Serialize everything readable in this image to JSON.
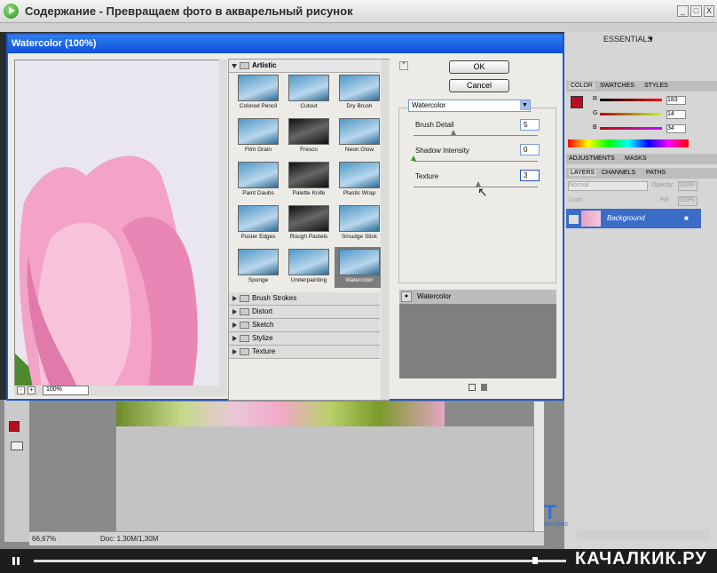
{
  "player": {
    "title": "Содержание - Превращаем фото в акварельный рисунок",
    "watermark": "КАЧАЛКИК.РУ",
    "min": "_",
    "max": "□",
    "close": "X"
  },
  "ps": {
    "essentials": "ESSENTIALS",
    "zoom": "66,67%",
    "doc": "Doc: 1,30M/1,30M"
  },
  "dialog": {
    "title": "Watercolor (100%)",
    "preview_zoom": "100%",
    "ok": "OK",
    "cancel": "Cancel",
    "filter_select": "Watercolor",
    "effect_layer": "Watercolor"
  },
  "gallery": {
    "artistic": "Artistic",
    "thumbs": [
      "Colored Pencil",
      "Cutout",
      "Dry Brush",
      "Film Grain",
      "Fresco",
      "Neon Glow",
      "Paint Daubs",
      "Palette Knife",
      "Plastic Wrap",
      "Poster Edges",
      "Rough Pastels",
      "Smudge Stick",
      "Sponge",
      "Underpainting",
      "Watercolor"
    ],
    "folders": [
      "Brush Strokes",
      "Distort",
      "Sketch",
      "Stylize",
      "Texture"
    ]
  },
  "params": {
    "brush_detail_label": "Brush Detail",
    "brush_detail": "5",
    "shadow_label": "Shadow Intensity",
    "shadow": "0",
    "texture_label": "Texture",
    "texture": "3"
  },
  "panels": {
    "tabs1": [
      "COLOR",
      "SWATCHES",
      "STYLES"
    ],
    "r": "R",
    "g": "G",
    "b": "B",
    "r_val": "183",
    "g_val": "14",
    "b_val": "34",
    "tabs2": [
      "ADJUSTMENTS",
      "MASKS"
    ],
    "tabs3": [
      "LAYERS",
      "CHANNELS",
      "PATHS"
    ],
    "blend": "Normal",
    "opacity": "Opacity:",
    "opacity_val": "100%",
    "lock": "Lock:",
    "fill": "Fill:",
    "fill_val": "100%",
    "layer": "Background",
    "brand": "Т",
    "brand2": "Интерес"
  },
  "colors": {
    "accent": "#b90e22"
  }
}
